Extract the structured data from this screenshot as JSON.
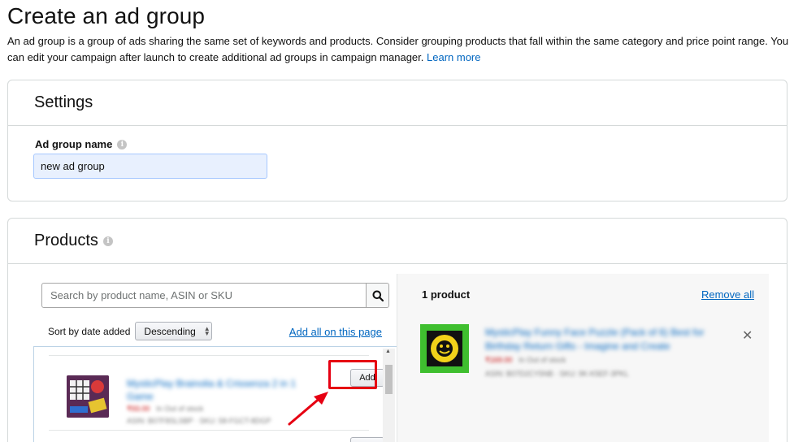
{
  "header": {
    "title": "Create an ad group",
    "intro": "An ad group is a group of ads sharing the same set of keywords and products. Consider grouping products that fall within the same category and price point range. You can edit your campaign after launch to create additional ad groups in campaign manager.",
    "learn_more": "Learn more"
  },
  "settings": {
    "heading": "Settings",
    "name_label": "Ad group name",
    "name_value": "new ad group"
  },
  "products": {
    "heading": "Products",
    "search_placeholder": "Search by product name, ASIN or SKU",
    "sort_label": "Sort by date added",
    "sort_value": "Descending",
    "add_all": "Add all on this page",
    "list": [
      {
        "title": "MysticPlay Brainolia & Crissenza 2 in 1 Game",
        "price": "₹93.00",
        "stock": "In Out of stock",
        "ids": "ASIN: B07F8SLSBP · SKU: 58-FGCT-8DGP",
        "add_label": "Add"
      }
    ],
    "added": {
      "count": "1 product",
      "remove_all": "Remove all",
      "items": [
        {
          "title": "MysticPlay Funny Face Puzzle (Pack of 6) Best for Birthday Return Gifts - Imagine and Create",
          "price": "₹169.00",
          "stock": "In Out of stock",
          "ids": "ASIN: B07D2CY5NB · SKU: 9K-K5EF-3PKL"
        }
      ]
    }
  },
  "colors": {
    "link": "#0066c0",
    "highlight": "#e60012",
    "input_fill": "#e8f0fe"
  }
}
